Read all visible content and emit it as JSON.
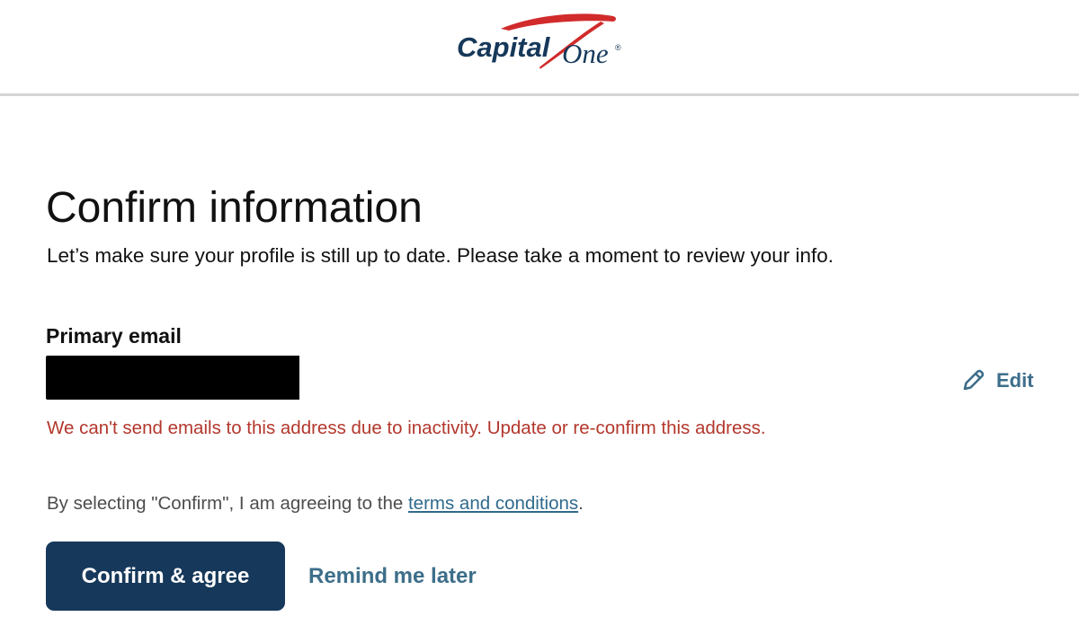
{
  "header": {
    "logo_text_capital": "Capital",
    "logo_text_one": "One",
    "logo_registered": "®"
  },
  "main": {
    "title": "Confirm information",
    "subtitle": "Let’s make sure your profile is still up to date. Please take a moment to review your info.",
    "email_section": {
      "label": "Primary email",
      "edit_label": "Edit",
      "error": "We can't send emails to this address due to inactivity. Update or re-confirm this address."
    },
    "terms": {
      "prefix": "By selecting \"Confirm\", I am agreeing to the ",
      "link_text": "terms and conditions",
      "suffix": "."
    },
    "actions": {
      "confirm_label": "Confirm & agree",
      "remind_label": "Remind me later"
    }
  },
  "colors": {
    "brand_navy": "#16385a",
    "brand_red": "#d12b2b",
    "link_blue": "#3d6e8a",
    "error_red": "#b3372c"
  },
  "icons": {
    "edit": "pencil-icon"
  }
}
